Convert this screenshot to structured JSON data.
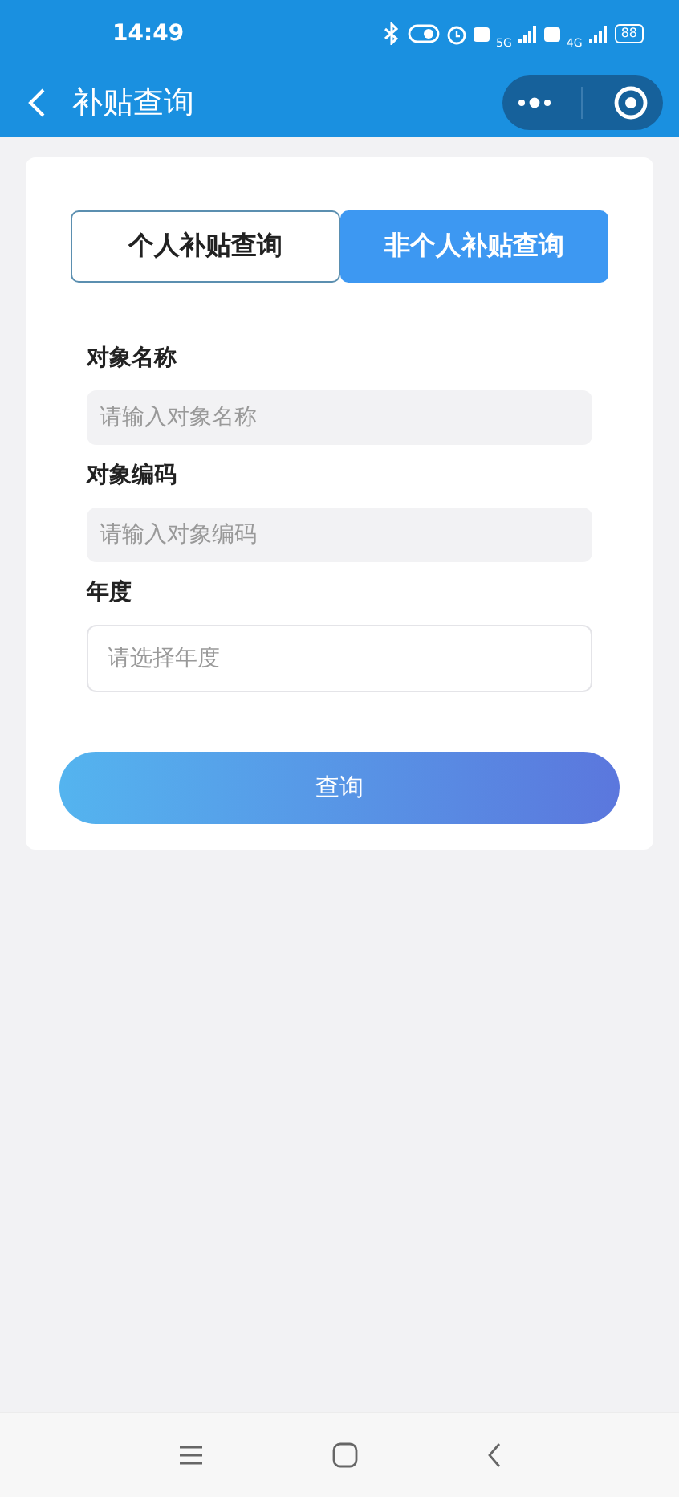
{
  "status_bar": {
    "time": "14:49",
    "net1": "5G",
    "net2": "4G",
    "battery": "88"
  },
  "nav": {
    "title": "补贴查询"
  },
  "tabs": [
    {
      "label": "个人补贴查询",
      "selected": false
    },
    {
      "label": "非个人补贴查询",
      "selected": true
    }
  ],
  "fields": [
    {
      "label": "对象名称",
      "placeholder": "请输入对象名称",
      "kind": "input"
    },
    {
      "label": "对象编码",
      "placeholder": "请输入对象编码",
      "kind": "input"
    },
    {
      "label": "年度",
      "placeholder": "请选择年度",
      "kind": "select"
    }
  ],
  "submit": "查询"
}
